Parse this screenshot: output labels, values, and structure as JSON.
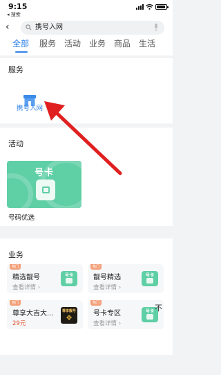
{
  "statusbar": {
    "time": "9:15",
    "back_label": "◂ 搜索",
    "battery_level": 0.9
  },
  "search": {
    "query": "携号入网",
    "back_icon": "chevron-left-icon",
    "search_icon": "search-icon",
    "mic_icon": "microphone-icon"
  },
  "tabs": [
    {
      "label": "全部",
      "active": true
    },
    {
      "label": "服务",
      "active": false
    },
    {
      "label": "活动",
      "active": false
    },
    {
      "label": "业务",
      "active": false
    },
    {
      "label": "商品",
      "active": false
    },
    {
      "label": "生活",
      "active": false
    }
  ],
  "services": {
    "title": "服务",
    "items": [
      {
        "label": "携号入网",
        "icon": "shop-icon"
      }
    ]
  },
  "activities": {
    "title": "活动",
    "items": [
      {
        "banner_title": "号卡",
        "label": "号码优选"
      }
    ]
  },
  "business": {
    "title": "业务",
    "items": [
      {
        "badge": "热门",
        "title": "精选靓号",
        "subtitle": "查看详情 ›",
        "thumb_text": "号卡"
      },
      {
        "badge": "热门",
        "title": "靓号精选",
        "subtitle": "查看详情 ›",
        "thumb_text": "号卡"
      },
      {
        "badge": "热门",
        "title": "尊享大吉大...",
        "price": "29元",
        "thumb_text": "尊享靓号"
      },
      {
        "badge": "热门",
        "title": "号卡专区",
        "subtitle": "查看详情 ›",
        "thumb_text": "号卡"
      }
    ]
  },
  "overlay": {
    "float_label": "不"
  },
  "colors": {
    "accent": "#2f82e8",
    "card_green": "#5fcfa5",
    "badge": "#f3a07a",
    "arrow": "#e02020"
  }
}
